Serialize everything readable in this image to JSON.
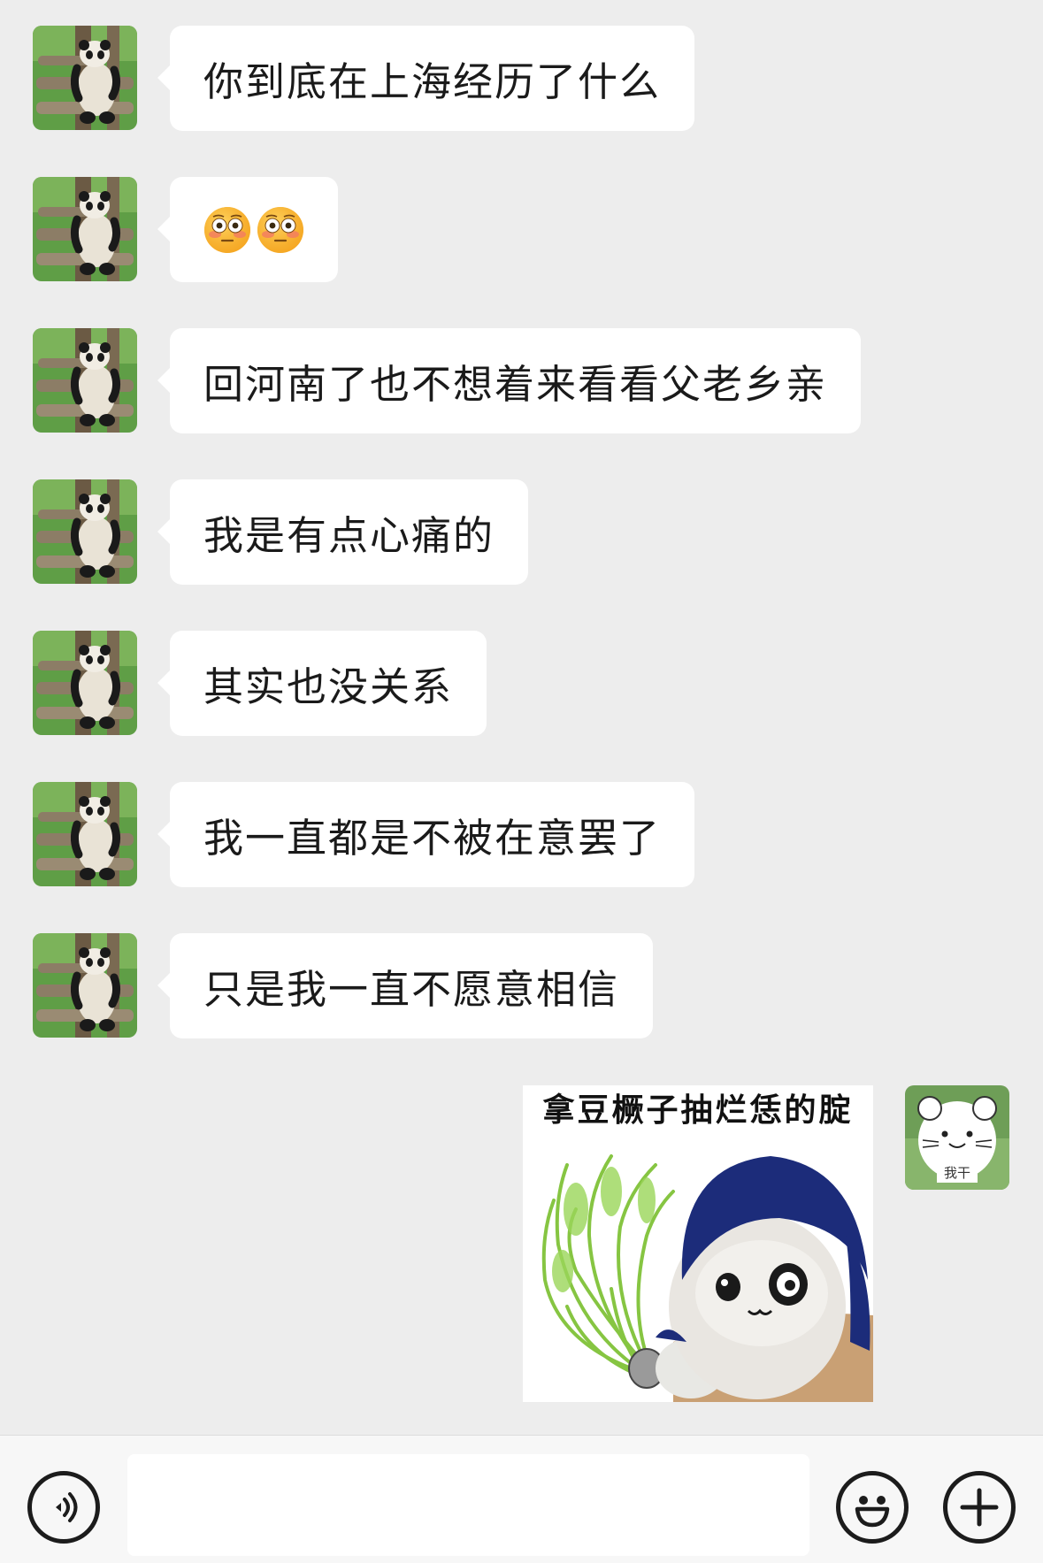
{
  "messages": [
    {
      "from": "contact",
      "type": "text",
      "text": "你到底在上海经历了什么"
    },
    {
      "from": "contact",
      "type": "emoji",
      "emoji": [
        "flushed-face-emoji",
        "flushed-face-emoji"
      ]
    },
    {
      "from": "contact",
      "type": "text",
      "text": "回河南了也不想着来看看父老乡亲"
    },
    {
      "from": "contact",
      "type": "text",
      "text": "我是有点心痛的"
    },
    {
      "from": "contact",
      "type": "text",
      "text": "其实也没关系"
    },
    {
      "from": "contact",
      "type": "text",
      "text": "我一直都是不被在意罢了"
    },
    {
      "from": "contact",
      "type": "text",
      "text": "只是我一直不愿意相信"
    },
    {
      "from": "me",
      "type": "sticker",
      "caption": "拿豆橛子抽烂恁的腚"
    }
  ],
  "me_avatar": {
    "label": "我干"
  },
  "contact_avatar": {
    "icon": "panda-avatar"
  },
  "input_bar": {
    "voice_icon": "voice-icon",
    "input_value": "",
    "emoji_icon": "emoji-icon",
    "more_icon": "plus-icon"
  },
  "colors": {
    "background": "#ededed",
    "bubble_in": "#ffffff",
    "bar": "#f7f7f7"
  }
}
